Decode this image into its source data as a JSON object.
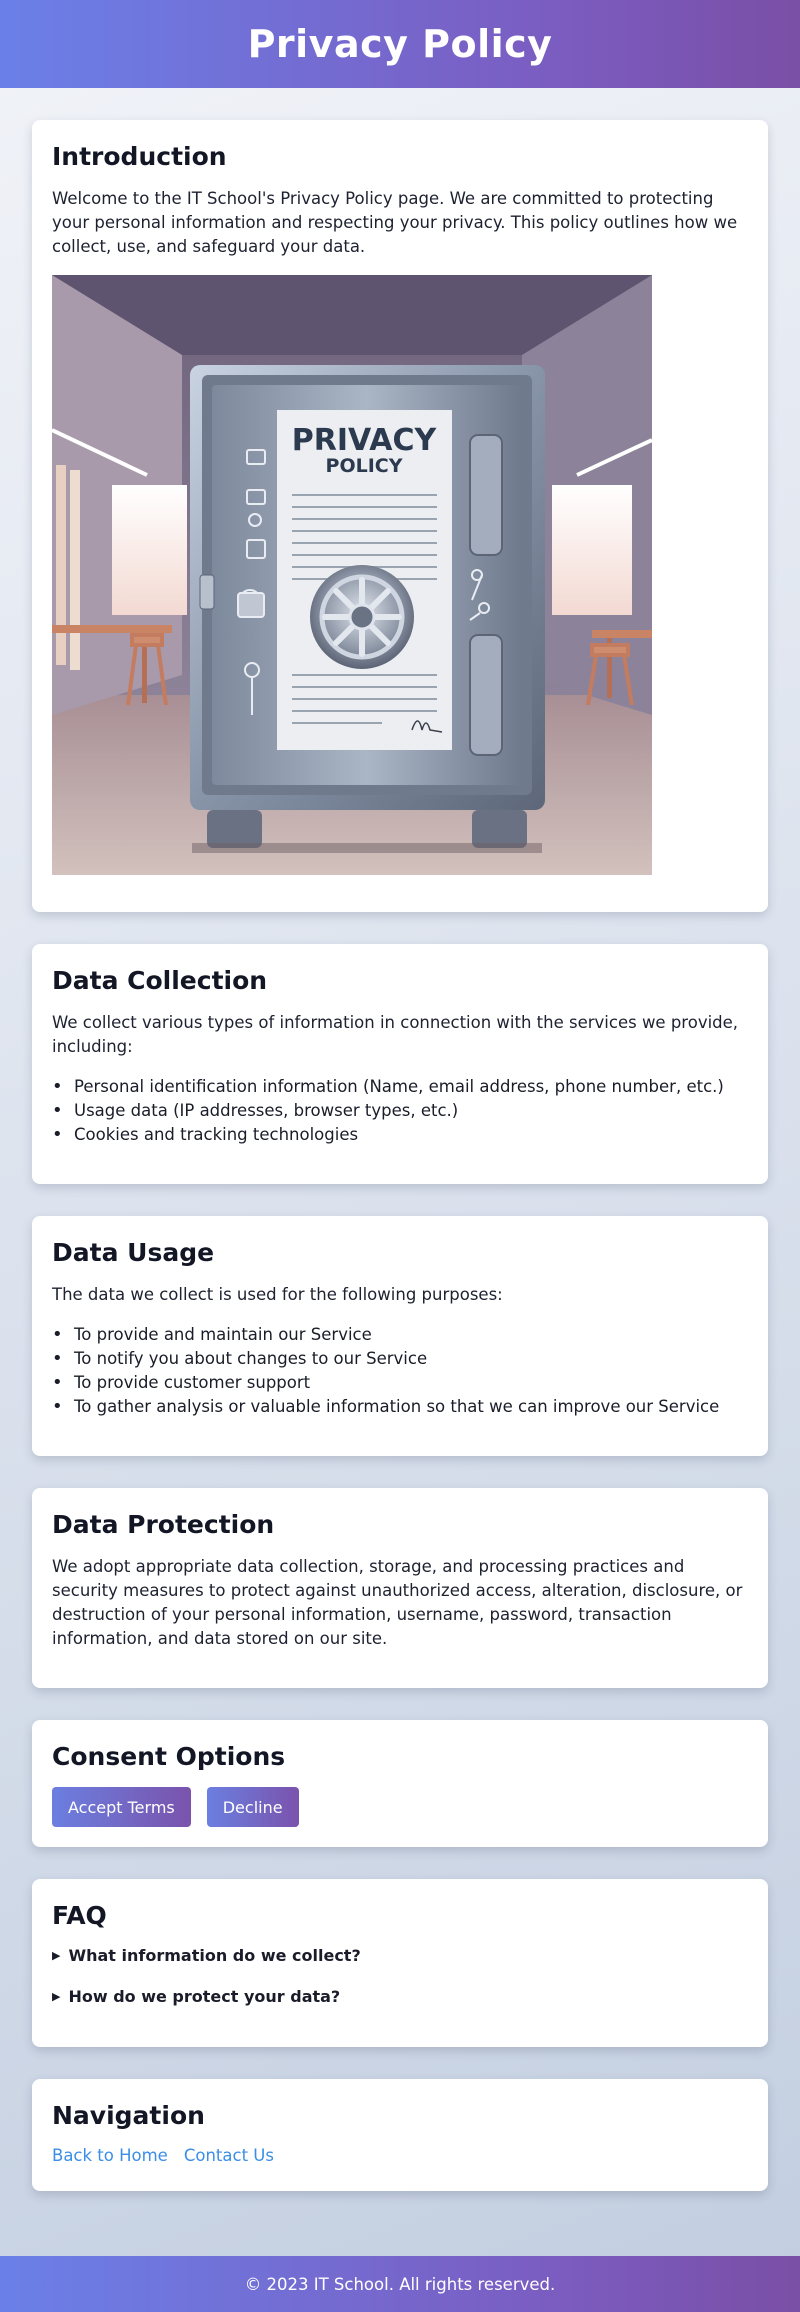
{
  "header": {
    "title": "Privacy Policy"
  },
  "intro": {
    "heading": "Introduction",
    "text": "Welcome to the IT School's Privacy Policy page. We are committed to protecting your personal information and respecting your privacy. This policy outlines how we collect, use, and safeguard your data.",
    "image": {
      "title_line1": "PRIVACY",
      "title_line2": "POLICY"
    }
  },
  "collection": {
    "heading": "Data Collection",
    "text": "We collect various types of information in connection with the services we provide, including:",
    "items": [
      "Personal identification information (Name, email address, phone number, etc.)",
      "Usage data (IP addresses, browser types, etc.)",
      "Cookies and tracking technologies"
    ]
  },
  "usage": {
    "heading": "Data Usage",
    "text": "The data we collect is used for the following purposes:",
    "items": [
      "To provide and maintain our Service",
      "To notify you about changes to our Service",
      "To provide customer support",
      "To gather analysis or valuable information so that we can improve our Service"
    ]
  },
  "protection": {
    "heading": "Data Protection",
    "text": "We adopt appropriate data collection, storage, and processing practices and security measures to protect against unauthorized access, alteration, disclosure, or destruction of your personal information, username, password, transaction information, and data stored on our site."
  },
  "consent": {
    "heading": "Consent Options",
    "accept_label": "Accept Terms",
    "decline_label": "Decline"
  },
  "faq": {
    "heading": "FAQ",
    "items": [
      "What information do we collect?",
      "How do we protect your data?"
    ]
  },
  "navigation": {
    "heading": "Navigation",
    "links": [
      "Back to Home",
      "Contact Us"
    ]
  },
  "footer": {
    "text": "© 2023 IT School. All rights reserved."
  },
  "colors": {
    "header_gradient_start": "#6a80e8",
    "header_gradient_end": "#7a4fa6",
    "link": "#3b8ee8",
    "button_gradient_start": "#6b7fe0",
    "button_gradient_end": "#7a53ac"
  }
}
